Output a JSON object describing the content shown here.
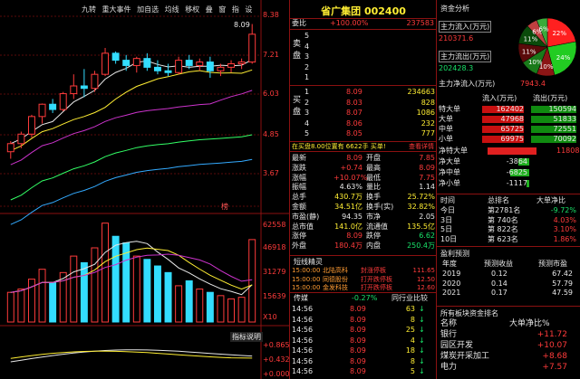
{
  "toolbar": {
    "items": [
      "九转",
      "重大事件",
      "加自选",
      "均线",
      "移权",
      "叠",
      "窗",
      "指",
      "设"
    ]
  },
  "kline": {
    "price_ticks": [
      "8.38",
      "7.21",
      "6.03",
      "4.85",
      "3.67"
    ],
    "latest_marker": "8.09",
    "vol_ticks": [
      "62558",
      "46918",
      "31279",
      "15639",
      "X10"
    ],
    "indicator_ticks": [
      "+0.865",
      "+0.432",
      "+0.000"
    ],
    "indicator_label": "指标说明",
    "badge": "榜"
  },
  "chart_data": [
    {
      "type": "candlestick",
      "title": "",
      "x": [
        1,
        2,
        3,
        4,
        5,
        6,
        7,
        8,
        9,
        10,
        11,
        12,
        13,
        14,
        15,
        16,
        17,
        18,
        19,
        20,
        21,
        22,
        23,
        24
      ],
      "ohlc": [
        [
          4.75,
          5.05,
          4.55,
          4.98
        ],
        [
          4.98,
          5.32,
          4.85,
          5.25
        ],
        [
          5.25,
          5.8,
          5.15,
          5.75
        ],
        [
          5.75,
          6.12,
          5.55,
          6.1
        ],
        [
          6.1,
          6.25,
          5.85,
          5.95
        ],
        [
          5.95,
          6.45,
          5.9,
          6.4
        ],
        [
          6.4,
          6.95,
          6.25,
          6.62
        ],
        [
          6.62,
          7.1,
          6.3,
          6.55
        ],
        [
          6.55,
          7.05,
          6.45,
          6.95
        ],
        [
          6.95,
          7.7,
          6.9,
          7.55
        ],
        [
          7.55,
          7.6,
          7.25,
          7.35
        ],
        [
          7.35,
          7.5,
          7.05,
          7.2
        ],
        [
          7.2,
          7.45,
          7.0,
          7.4
        ],
        [
          7.4,
          7.55,
          7.05,
          7.15
        ],
        [
          7.15,
          7.35,
          6.95,
          7.05
        ],
        [
          7.05,
          7.25,
          6.9,
          7.0
        ],
        [
          7.0,
          7.45,
          6.95,
          7.35
        ],
        [
          7.35,
          7.5,
          7.1,
          7.2
        ],
        [
          7.2,
          7.4,
          7.05,
          7.3
        ],
        [
          7.3,
          7.45,
          6.85,
          7.05
        ],
        [
          7.05,
          7.25,
          6.9,
          7.15
        ],
        [
          7.15,
          7.35,
          7.0,
          7.25
        ],
        [
          7.25,
          7.4,
          7.1,
          7.3
        ],
        [
          7.3,
          8.38,
          7.25,
          8.09
        ]
      ],
      "ylim": [
        3.2,
        8.6
      ]
    },
    {
      "type": "bar",
      "title": "volume",
      "values": [
        18000,
        20000,
        26000,
        32000,
        24000,
        30000,
        40000,
        36000,
        45000,
        60000,
        52000,
        48000,
        40000,
        38000,
        34000,
        30000,
        22000,
        25000,
        20000,
        18000,
        16000,
        14000,
        15000,
        50000
      ],
      "ylim": [
        0,
        62558
      ]
    }
  ],
  "quote": {
    "name": "省广集团",
    "code": "002400",
    "weibi_label": "委比",
    "weibi_value": "+100.00%",
    "weicha_value": "237583",
    "sell_label": "卖盘",
    "buy_label": "买盘",
    "asks": [
      {
        "level": "5",
        "price": "",
        "vol": ""
      },
      {
        "level": "4",
        "price": "",
        "vol": ""
      },
      {
        "level": "3",
        "price": "",
        "vol": ""
      },
      {
        "level": "2",
        "price": "",
        "vol": ""
      },
      {
        "level": "1",
        "price": "",
        "vol": ""
      }
    ],
    "bids": [
      {
        "level": "1",
        "price": "8.09",
        "vol": "234663"
      },
      {
        "level": "2",
        "price": "8.03",
        "vol": "828"
      },
      {
        "level": "3",
        "price": "8.07",
        "vol": "1086"
      },
      {
        "level": "4",
        "price": "8.06",
        "vol": "232"
      },
      {
        "level": "5",
        "price": "8.05",
        "vol": "777"
      }
    ],
    "order_note": "在买盘8.00位置有 6622手 买单!",
    "order_link": "查看详情",
    "stats_left": [
      {
        "k": "最新",
        "v": "8.09",
        "c": "r"
      },
      {
        "k": "涨跌",
        "v": "+0.74",
        "c": "r"
      },
      {
        "k": "涨幅",
        "v": "+10.07%",
        "c": "r"
      },
      {
        "k": "振幅",
        "v": "4.63%",
        "c": "w"
      },
      {
        "k": "总手",
        "v": "430.7万",
        "c": "y"
      },
      {
        "k": "金额",
        "v": "34.51亿",
        "c": "y"
      },
      {
        "k": "市盈(静)",
        "v": "94.35",
        "c": "w"
      },
      {
        "k": "总市值",
        "v": "141.0亿",
        "c": "y"
      },
      {
        "k": "涨停",
        "v": "8.09",
        "c": "r"
      },
      {
        "k": "外盘",
        "v": "180.4万",
        "c": "r"
      }
    ],
    "stats_right": [
      {
        "k": "开盘",
        "v": "7.85",
        "c": "r"
      },
      {
        "k": "最高",
        "v": "8.09",
        "c": "r"
      },
      {
        "k": "最低",
        "v": "7.75",
        "c": "r"
      },
      {
        "k": "量比",
        "v": "1.14",
        "c": "w"
      },
      {
        "k": "换手",
        "v": "25.72%",
        "c": "y"
      },
      {
        "k": "换手(实)",
        "v": "32.82%",
        "c": "y"
      },
      {
        "k": "市净",
        "v": "2.05",
        "c": "w"
      },
      {
        "k": "流通值",
        "v": "135.5亿",
        "c": "y"
      },
      {
        "k": "跌停",
        "v": "6.62",
        "c": "g"
      },
      {
        "k": "内盘",
        "v": "250.4万",
        "c": "g"
      }
    ]
  },
  "news": {
    "title": "短线精灵",
    "items": [
      {
        "time": "15:00:00",
        "name": "北陆高科",
        "event": "封涨停板",
        "val": "111.65"
      },
      {
        "time": "15:00:00",
        "name": "同德股份",
        "event": "打开跌停板",
        "val": "12.50"
      },
      {
        "time": "15:00:00",
        "name": "金发科技",
        "event": "打开跌停板",
        "val": "12.60"
      }
    ]
  },
  "ticks": {
    "tab_label": "传媒",
    "tab_change": "-0.27%",
    "tab_right": "同行业比较",
    "rows": [
      {
        "time": "14:56",
        "price": "8.09",
        "vol": "63"
      },
      {
        "time": "14:56",
        "price": "8.09",
        "vol": "8"
      },
      {
        "time": "14:56",
        "price": "8.09",
        "vol": "25"
      },
      {
        "time": "14:56",
        "price": "8.09",
        "vol": "4"
      },
      {
        "time": "14:56",
        "price": "8.09",
        "vol": "18"
      },
      {
        "time": "14:56",
        "price": "8.09",
        "vol": "8"
      },
      {
        "time": "14:56",
        "price": "8.09",
        "vol": "5"
      }
    ]
  },
  "fund": {
    "title": "资金分析",
    "inflow_label": "主力流入(万元)",
    "inflow_value": "210371.6",
    "outflow_label": "主力流出(万元)",
    "outflow_value": "202428.3",
    "net_label": "主力净流入(万元)",
    "net_value": "7943.4",
    "pie": [
      {
        "label": "22%",
        "value": 22,
        "color": "#ff2020"
      },
      {
        "label": "24%",
        "value": 24,
        "color": "#22cc22"
      },
      {
        "label": "10%",
        "value": 10,
        "color": "#8b1515"
      },
      {
        "label": "10%",
        "value": 10,
        "color": "#1a7a1a"
      },
      {
        "label": "11%",
        "value": 11,
        "color": "#5a0a0a"
      },
      {
        "label": "11%",
        "value": 11,
        "color": "#0a4a0a"
      },
      {
        "label": "6%",
        "value": 6,
        "color": "#c04040"
      },
      {
        "label": "6%",
        "value": 6,
        "color": "#3aaa3a"
      }
    ],
    "flow_in_header": "流入(万元)",
    "flow_out_header": "流出(万元)",
    "flow_rows": [
      {
        "name": "特大单",
        "in": "162402",
        "out": "150594"
      },
      {
        "name": "大单",
        "in": "47968",
        "out": "51833"
      },
      {
        "name": "中单",
        "in": "65725",
        "out": "72551"
      },
      {
        "name": "小单",
        "in": "69975",
        "out": "70092"
      }
    ],
    "net_rows": [
      {
        "name": "净特大单",
        "value": "11808",
        "frac": 0.9
      },
      {
        "name": "净大单",
        "value": "-3864",
        "frac": 0.3
      },
      {
        "name": "净中单",
        "value": "-6825",
        "frac": 0.52
      },
      {
        "name": "净小单",
        "value": "-1117",
        "frac": 0.08
      }
    ]
  },
  "rank": {
    "headers": [
      "时间",
      "总排名",
      "大单净比"
    ],
    "rows": [
      {
        "t": "今日",
        "rank": "第2781名",
        "pct": "-9.72%",
        "c": "g"
      },
      {
        "t": "3日",
        "rank": "第 740名",
        "pct": "4.03%",
        "c": "r"
      },
      {
        "t": "5日",
        "rank": "第 822名",
        "pct": "3.10%",
        "c": "r"
      },
      {
        "t": "10日",
        "rank": "第 623名",
        "pct": "1.86%",
        "c": "r"
      }
    ]
  },
  "forecast": {
    "title": "盈利预测",
    "headers": [
      "年度",
      "预测收益",
      "预测市盈"
    ],
    "rows": [
      {
        "year": "2019",
        "eps": "0.12",
        "pe": "67.42"
      },
      {
        "year": "2020",
        "eps": "0.14",
        "pe": "57.79"
      },
      {
        "year": "2021",
        "eps": "0.17",
        "pe": "47.59"
      }
    ]
  },
  "sector": {
    "title": "所有板块资金排名",
    "headers": [
      "名称",
      "大单净比%"
    ],
    "rows": [
      {
        "name": "银行",
        "v": "+11.72"
      },
      {
        "name": "园区开发",
        "v": "+10.07"
      },
      {
        "name": "煤炭开采加工",
        "v": "+8.68"
      },
      {
        "name": "电力",
        "v": "+7.57"
      }
    ]
  }
}
